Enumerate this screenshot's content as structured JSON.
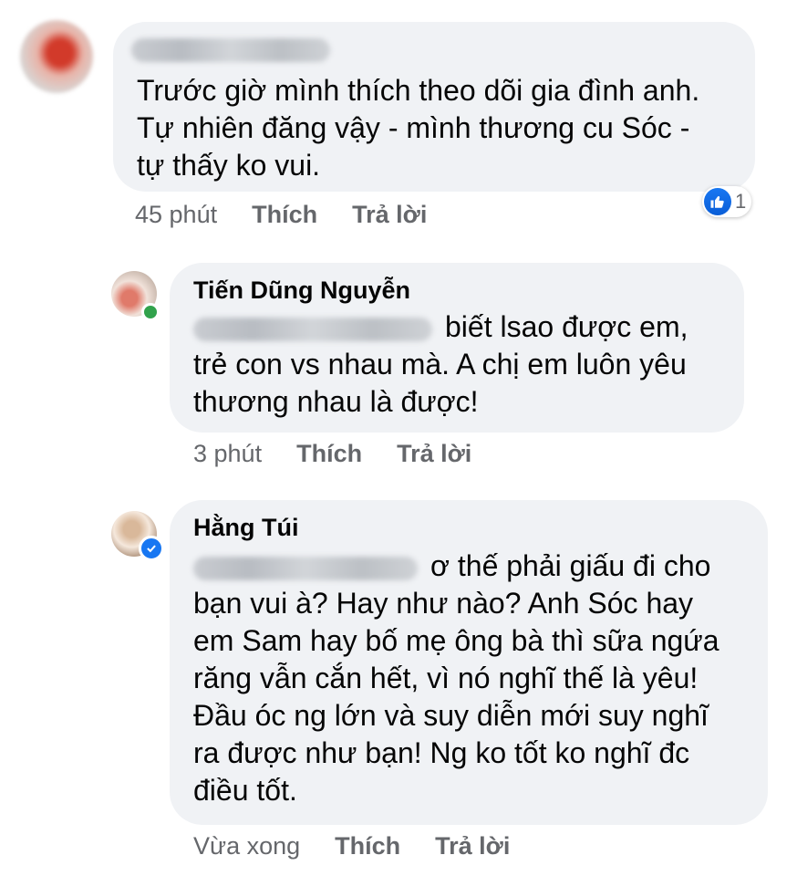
{
  "comments": [
    {
      "author_hidden": true,
      "text_lines": [
        "Trước giờ mình thích theo dõi gia đình anh.",
        "Tự nhiên đăng vậy - mình thương cu Sóc -",
        "tự thấy ko vui."
      ],
      "time": "45 phút",
      "like_label": "Thích",
      "reply_label": "Trả lời",
      "reaction_count": "1"
    },
    {
      "author": "Tiến Dũng Nguyễn",
      "text_first": "biết lsao được em,",
      "text_lines": [
        "trẻ con vs nhau mà. A chị em luôn yêu",
        "thương nhau là được!"
      ],
      "time": "3 phút",
      "like_label": "Thích",
      "reply_label": "Trả lời",
      "status": "online"
    },
    {
      "author": "Hằng Túi",
      "text_first": "ơ thế phải giấu đi cho",
      "text_lines": [
        "bạn vui à? Hay như nào? Anh Sóc hay",
        "em Sam hay bố mẹ ông bà thì sữa ngứa",
        "răng vẫn cắn hết, vì nó nghĩ thế là yêu!",
        "Đầu óc ng lớn và suy diễn mới suy nghĩ",
        "ra được như bạn! Ng ko tốt ko nghĩ đc",
        "điều tốt."
      ],
      "time": "Vừa xong",
      "like_label": "Thích",
      "reply_label": "Trả lời",
      "badge": "verified"
    }
  ],
  "colors": {
    "bubble": "#f0f2f5",
    "meta_text": "#65676b",
    "like_blue": "#1877f2",
    "online_green": "#31a24c"
  },
  "icons": [
    "thumbs-up-icon",
    "checkmark-icon"
  ]
}
